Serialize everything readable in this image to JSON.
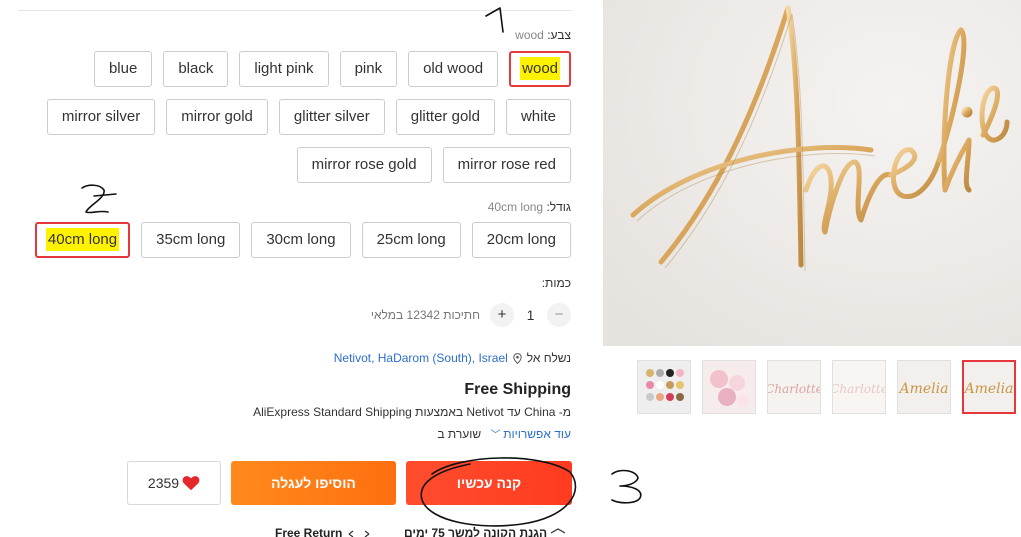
{
  "color": {
    "label": "צבע:",
    "selected": "wood",
    "options_row1": [
      "wood",
      "old wood",
      "pink",
      "light pink",
      "black",
      "blue"
    ],
    "options_row2": [
      "white",
      "glitter gold",
      "glitter silver",
      "mirror gold",
      "mirror silver"
    ],
    "options_row3": [
      "mirror rose red",
      "mirror rose gold"
    ]
  },
  "size": {
    "label": "גודל:",
    "selected": "40cm long",
    "options": [
      "20cm long",
      "25cm long",
      "30cm long",
      "35cm long",
      "40cm long"
    ]
  },
  "quantity": {
    "label": "כמות:",
    "minus": "−",
    "value": "1",
    "plus": "+",
    "stock": "חתיכות 12342 במלאי"
  },
  "shipping": {
    "ship_to_label": "נשלח אל",
    "location": "Netivot, HaDarom (South), Israel",
    "free_shipping": "Free Shipping",
    "method": "מ- China עד Netivot באמצעות AliExpress Standard Shipping",
    "arrival_label": "שוערת ב",
    "more_options": "עוד אפשרויות"
  },
  "actions": {
    "buy_now": "קנה עכשיו",
    "add_to_cart": "הוסיפו לעגלה",
    "wishlist_count": "2359"
  },
  "guarantees": {
    "buyer_protection": "הגנת הקונה למשך 75 ימים",
    "free_return": "Free Return"
  },
  "product_image": {
    "text": "Amelia"
  },
  "thumbnails": [
    {
      "name": "thumb-amelia-selected",
      "text": "Amelia"
    },
    {
      "name": "thumb-amelia-2",
      "text": "Amelia"
    },
    {
      "name": "thumb-charlotte-light",
      "text": "Charlotte"
    },
    {
      "name": "thumb-charlotte-rose",
      "text": "Charlotte"
    },
    {
      "name": "thumb-flowers",
      "text": ""
    },
    {
      "name": "thumb-color-swatches",
      "text": ""
    }
  ],
  "annotations": {
    "one": "1",
    "two": "2",
    "three": "3"
  },
  "colors": {
    "accent_red": "#e5383c",
    "buy_orange_red": "#ff4d2e",
    "cart_orange": "#ff7a15",
    "highlight_yellow": "#fff200",
    "link_blue": "#2d6ecd",
    "gold": "#e0b46a"
  }
}
